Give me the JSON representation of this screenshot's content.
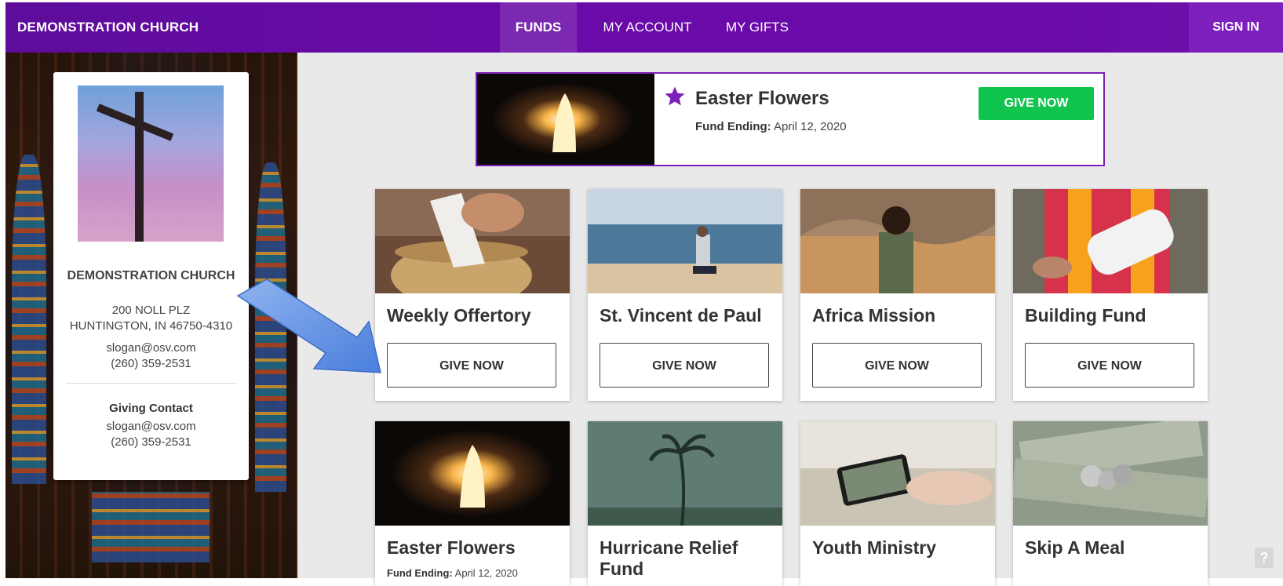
{
  "header": {
    "brand": "DEMONSTRATION CHURCH",
    "nav": [
      "FUNDS",
      "MY ACCOUNT",
      "MY GIFTS"
    ],
    "active_nav": "FUNDS",
    "sign_in": "SIGN IN"
  },
  "church": {
    "name": "DEMONSTRATION CHURCH",
    "address_line1": "200 NOLL PLZ",
    "address_line2": "HUNTINGTON, IN 46750-4310",
    "email": "slogan@osv.com",
    "phone": "(260) 359-2531",
    "giving_contact": {
      "label": "Giving Contact",
      "email": "slogan@osv.com",
      "phone": "(260) 359-2531"
    }
  },
  "featured": {
    "title": "Easter Flowers",
    "ending_label": "Fund Ending:",
    "ending_date": "April 12, 2020",
    "button": "GIVE NOW"
  },
  "funds": [
    {
      "title": "Weekly Offertory",
      "button": "GIVE NOW"
    },
    {
      "title": "St. Vincent de Paul",
      "button": "GIVE NOW"
    },
    {
      "title": "Africa Mission",
      "button": "GIVE NOW"
    },
    {
      "title": "Building Fund",
      "button": "GIVE NOW"
    },
    {
      "title": "Easter Flowers",
      "ending_label": "Fund Ending:",
      "ending_date": "April 12, 2020"
    },
    {
      "title": "Hurricane Relief Fund"
    },
    {
      "title": "Youth Ministry"
    },
    {
      "title": "Skip A Meal"
    }
  ],
  "help": "?",
  "colors": {
    "header_purple": "#6a0aa8",
    "give_green": "#10c44e",
    "featured_border": "#7b21b8"
  }
}
